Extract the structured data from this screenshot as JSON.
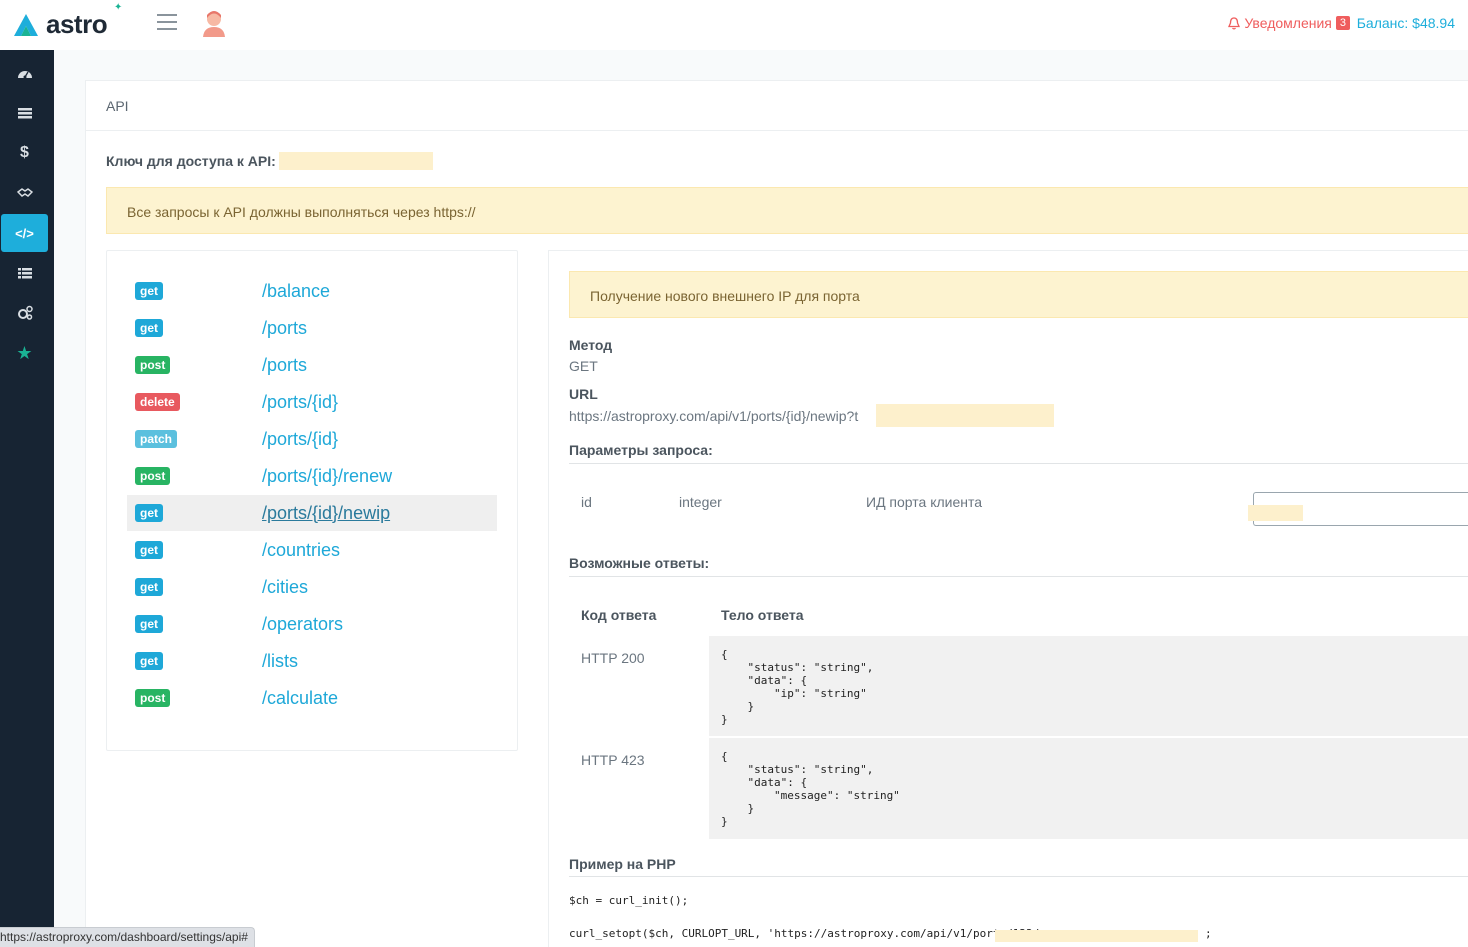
{
  "app": {
    "logo_text": "astro"
  },
  "header": {
    "notifications_label": "Уведомления",
    "notifications_count": "3",
    "balance": "Баланс: $48.94"
  },
  "sidebar": {
    "items": [
      {
        "icon": "dashboard-icon"
      },
      {
        "icon": "server-icon"
      },
      {
        "icon": "dollar-icon"
      },
      {
        "icon": "handshake-icon"
      },
      {
        "icon": "code-icon",
        "active": true
      },
      {
        "icon": "list-icon"
      },
      {
        "icon": "gears-icon"
      },
      {
        "icon": "star-icon"
      }
    ]
  },
  "page": {
    "title": "API",
    "api_key_label": "Ключ для доступа к API:",
    "https_notice": "Все запросы к API должны выполняться через https://"
  },
  "endpoints": [
    {
      "method": "get",
      "path": "/balance"
    },
    {
      "method": "get",
      "path": "/ports"
    },
    {
      "method": "post",
      "path": "/ports"
    },
    {
      "method": "delete",
      "path": "/ports/{id}"
    },
    {
      "method": "patch",
      "path": "/ports/{id}"
    },
    {
      "method": "post",
      "path": "/ports/{id}/renew"
    },
    {
      "method": "get",
      "path": "/ports/{id}/newip",
      "selected": true
    },
    {
      "method": "get",
      "path": "/countries"
    },
    {
      "method": "get",
      "path": "/cities"
    },
    {
      "method": "get",
      "path": "/operators"
    },
    {
      "method": "get",
      "path": "/lists"
    },
    {
      "method": "post",
      "path": "/calculate"
    }
  ],
  "detail": {
    "description": "Получение нового внешнего IP для порта",
    "method_label": "Метод",
    "method_value": "GET",
    "url_label": "URL",
    "url_value": "https://astroproxy.com/api/v1/ports/{id}/newip?t",
    "params_label": "Параметры запроса:",
    "params": [
      {
        "name": "id",
        "type": "integer",
        "desc": "ИД порта клиента"
      }
    ],
    "responses_label": "Возможные ответы:",
    "responses_col_code": "Код ответа",
    "responses_col_body": "Тело ответа",
    "responses": [
      {
        "code": "HTTP 200",
        "body": "{\n    \"status\": \"string\",\n    \"data\": {\n        \"ip\": \"string\"\n    }\n}"
      },
      {
        "code": "HTTP 423",
        "body": "{\n    \"status\": \"string\",\n    \"data\": {\n        \"message\": \"string\"\n    }\n}"
      }
    ],
    "php_label": "Пример на PHP",
    "php_line1": "$ch = curl_init();",
    "php_line2": "curl_setopt($ch, CURLOPT_URL, 'https://astroproxy.com/api/v1/ports/123/r",
    "php_line2_end": ";"
  },
  "statusbar": {
    "url": "https://astroproxy.com/dashboard/settings/api#"
  }
}
